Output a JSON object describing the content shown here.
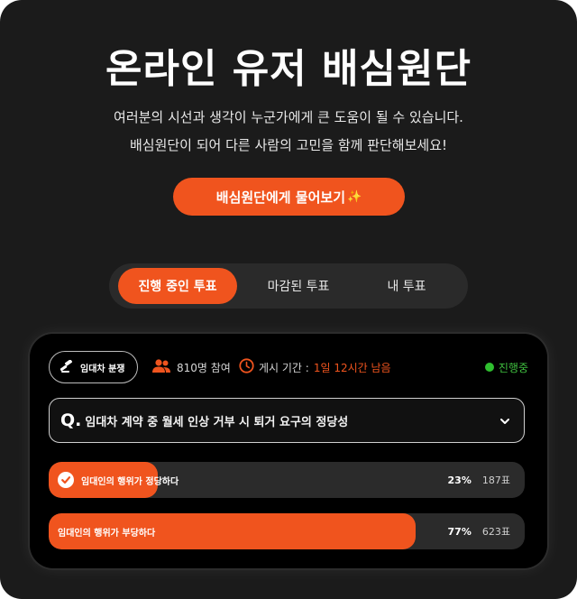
{
  "hero": {
    "title": "온라인 유저 배심원단",
    "desc_line1": "여러분의 시선과 생각이 누군가에게 큰 도움이 될 수 있습니다.",
    "desc_line2": "배심원단이 되어 다른 사람의 고민을 함께 판단해보세요!",
    "cta_label": "배심원단에게 물어보기",
    "cta_sparkle": "✨"
  },
  "tabs": [
    {
      "label": "진행 중인 투표",
      "active": true
    },
    {
      "label": "마감된 투표",
      "active": false
    },
    {
      "label": "내 투표",
      "active": false
    }
  ],
  "vote": {
    "category": "임대차 분쟁",
    "participants": "810명 참여",
    "deadline_label": "게시 기간 :",
    "deadline_remaining": "1일 12시간 남음",
    "status": "진행중",
    "question_prefix": "Q.",
    "question": "임대차 계약 중 월세 인상 거부 시 퇴거 요구의 정당성",
    "options": [
      {
        "label": "임대인의 행위가 정당하다",
        "percent_text": "23%",
        "count": "187표",
        "percent": 23,
        "selected": true
      },
      {
        "label": "임대인의 행위가 부당하다",
        "percent_text": "77%",
        "count": "623표",
        "percent": 77,
        "selected": false
      }
    ]
  },
  "colors": {
    "accent": "#f0541e",
    "background": "#1b1b1b",
    "card": "#000000",
    "status_green": "#2fbf2f"
  },
  "icons": [
    "gavel-icon",
    "people-icon",
    "clock-icon",
    "status-dot-icon",
    "chevron-down-icon",
    "check-circle-icon",
    "sparkle-icon"
  ]
}
